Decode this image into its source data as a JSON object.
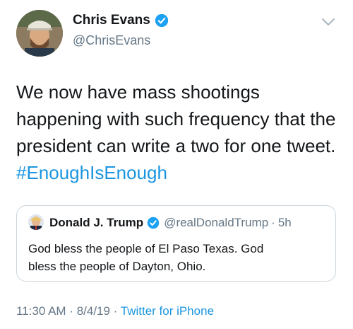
{
  "author": {
    "name": "Chris Evans",
    "handle": "@ChrisEvans",
    "avatar_icon": "profile-photo",
    "verified_icon": "verified-badge-icon"
  },
  "tweet": {
    "text": "We now have mass shootings\nhappening with such frequency that the\npresident can write a two for one tweet.",
    "hashtag": "#EnoughIsEnough"
  },
  "quoted_tweet": {
    "name": "Donald J. Trump",
    "handle": "@realDonaldTrump",
    "separator": "·",
    "time": "5h",
    "text": "God bless the people of El Paso Texas. God\nbless the people of Dayton, Ohio."
  },
  "meta": {
    "time": "11:30 AM",
    "separator1": " · ",
    "date": "8/4/19",
    "separator2": " · ",
    "source": "Twitter for iPhone"
  },
  "colors": {
    "link": "#1b95e0",
    "secondary_text": "#657786",
    "border": "#ccd6dd"
  }
}
